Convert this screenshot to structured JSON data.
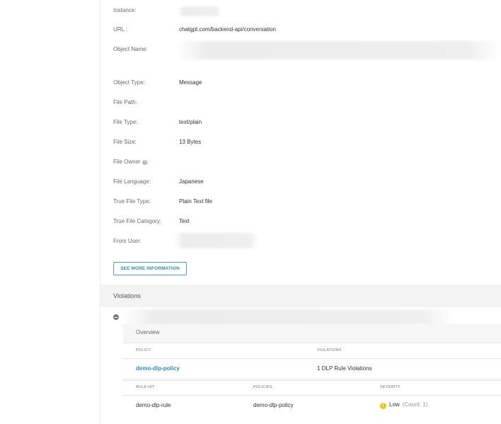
{
  "details": {
    "instance_label": "Instance:",
    "url_label": "URL :",
    "url_value": "chatgpt.com/backend-api/conversation",
    "object_name_label": "Object Name:",
    "object_type_label": "Object Type:",
    "object_type_value": "Message",
    "file_path_label": "File Path:",
    "file_type_label": "File Type:",
    "file_type_value": "text/plain",
    "file_size_label": "File Size:",
    "file_size_value": "13 Bytes",
    "file_owner_label": "File Owner",
    "file_owner_colon": ":",
    "file_language_label": "File Language:",
    "file_language_value": "Japanese",
    "true_file_type_label": "True File Type:",
    "true_file_type_value": "Plain Text file",
    "true_file_category_label": "True File Category:",
    "true_file_category_value": "Text",
    "from_user_label": "From User:"
  },
  "buttons": {
    "see_more": "SEE MORE INFORMATION"
  },
  "violations": {
    "title": "Violations",
    "overview_label": "Overview",
    "policy_table": {
      "headers": [
        "POLICY",
        "VIOLATIONS"
      ],
      "row": {
        "policy": "demo-dlp-policy",
        "violations": "1 DLP Rule Violations"
      }
    },
    "rule_table": {
      "headers": [
        "RULE HIT",
        "POLICIES",
        "SEVERITY"
      ],
      "row": {
        "rule": "demo-dlp-rule",
        "policies": "demo-dlp-policy",
        "severity": "Low",
        "count": "(Count: 1)"
      }
    }
  },
  "colors": {
    "link": "#2d8cb5",
    "severity_low": "#f2c21b",
    "button_border": "#4aa3c9"
  },
  "icons": {
    "help": "help-circle-icon",
    "collapse": "minus-circle-icon",
    "severity": "warning-circle-icon"
  }
}
